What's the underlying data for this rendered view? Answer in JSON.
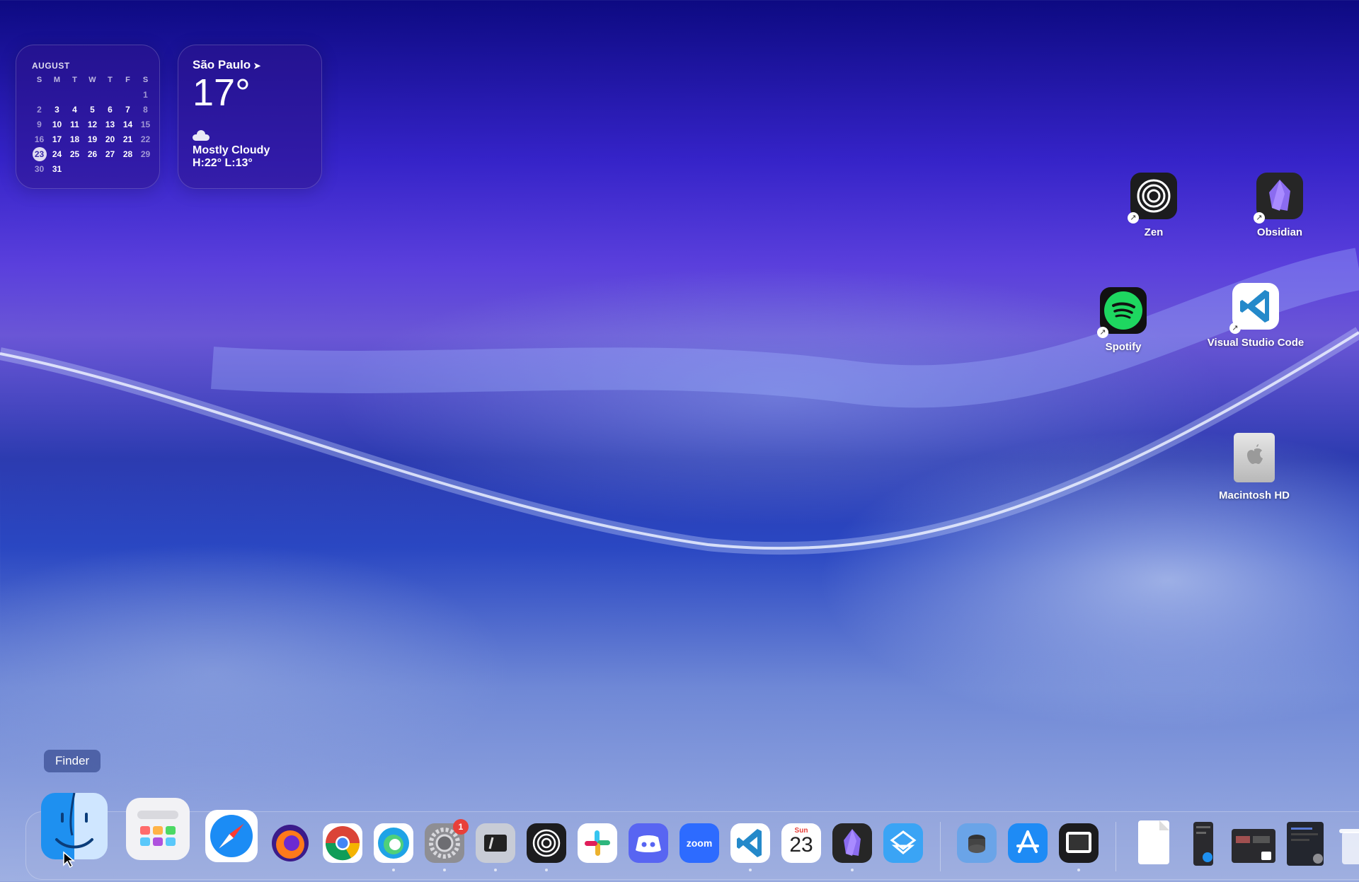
{
  "calendar": {
    "month": "AUGUST",
    "weekdays": [
      "S",
      "M",
      "T",
      "W",
      "T",
      "F",
      "S"
    ],
    "days": [
      [
        "",
        "",
        "",
        "",
        "",
        "",
        "1"
      ],
      [
        "2",
        "3",
        "4",
        "5",
        "6",
        "7",
        "8"
      ],
      [
        "9",
        "10",
        "11",
        "12",
        "13",
        "14",
        "15"
      ],
      [
        "16",
        "17",
        "18",
        "19",
        "20",
        "21",
        "22"
      ],
      [
        "23",
        "24",
        "25",
        "26",
        "27",
        "28",
        "29"
      ],
      [
        "30",
        "31",
        "",
        "",
        "",
        "",
        ""
      ]
    ],
    "today": "23"
  },
  "weather": {
    "city": "São Paulo",
    "temp": "17°",
    "condition": "Mostly Cloudy",
    "high_low": "H:22° L:13°"
  },
  "desktop_icons": {
    "zen": "Zen",
    "obsidian": "Obsidian",
    "spotify": "Spotify",
    "vscode": "Visual Studio Code",
    "macintosh_hd": "Macintosh HD"
  },
  "dock": {
    "tooltip": "Finder",
    "settings_badge": "1",
    "zoom_label": "zoom",
    "calendar_day": "Sun",
    "calendar_date": "23"
  },
  "colors": {
    "spotify": "#1ed760",
    "vscode": "#2489ca",
    "badge": "#e8403a",
    "zoom": "#2d6bff"
  }
}
